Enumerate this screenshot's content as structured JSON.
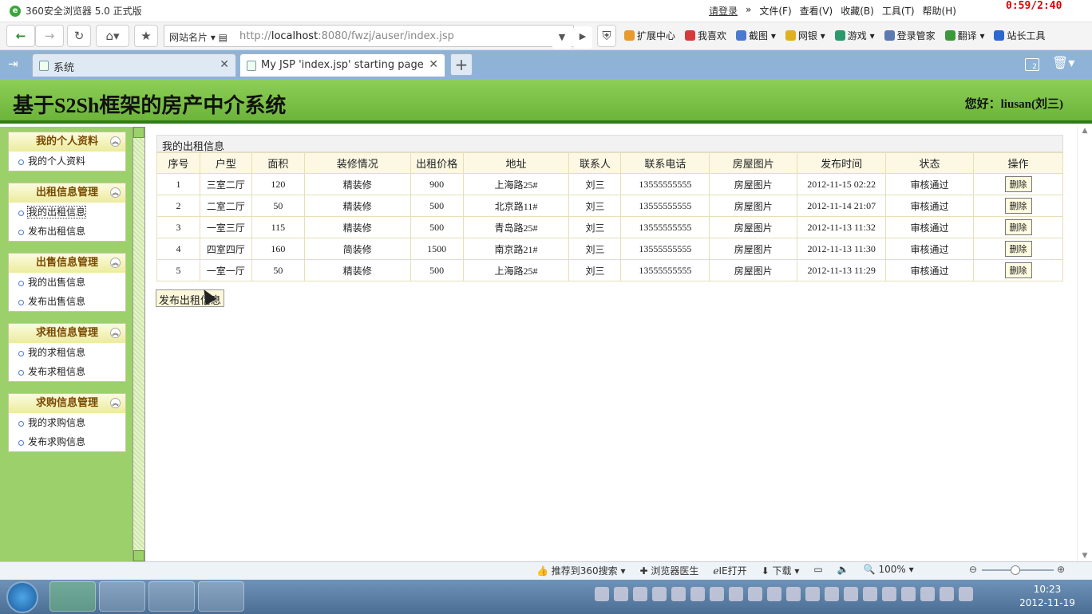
{
  "browser": {
    "title": "360安全浏览器 5.0 正式版",
    "login": "请登录",
    "menus": [
      "文件(F)",
      "查看(V)",
      "收藏(B)",
      "工具(T)",
      "帮助(H)"
    ],
    "overlay_timer": "0:59/2:40",
    "site_card": "网站名片",
    "url_prefix": "http://",
    "url_host": "localhost",
    "url_rest": ":8080/fwzj/auser/index.jsp",
    "extensions": [
      "扩展中心",
      "我喜欢",
      "截图",
      "网银",
      "游戏",
      "登录管家",
      "翻译",
      "站长工具"
    ],
    "tabs": [
      {
        "label": "系统"
      },
      {
        "label": "My JSP 'index.jsp' starting page"
      }
    ],
    "tab_count": "2"
  },
  "page": {
    "site_title": "基于S2Sh框架的房产中介系统",
    "greeting": "您好：liusan(刘三)",
    "sidebar": [
      {
        "title": "我的个人资料",
        "items": [
          "我的个人资料"
        ]
      },
      {
        "title": "出租信息管理",
        "items": [
          "我的出租信息",
          "发布出租信息"
        ]
      },
      {
        "title": "出售信息管理",
        "items": [
          "我的出售信息",
          "发布出售信息"
        ]
      },
      {
        "title": "求租信息管理",
        "items": [
          "我的求租信息",
          "发布求租信息"
        ]
      },
      {
        "title": "求购信息管理",
        "items": [
          "我的求购信息",
          "发布求购信息"
        ]
      }
    ],
    "table_caption": "我的出租信息",
    "columns": [
      "序号",
      "户型",
      "面积",
      "装修情况",
      "出租价格",
      "地址",
      "联系人",
      "联系电话",
      "房屋图片",
      "发布时间",
      "状态",
      "操作"
    ],
    "rows": [
      [
        "1",
        "三室二厅",
        "120",
        "精装修",
        "900",
        "上海路25#",
        "刘三",
        "13555555555",
        "房屋图片",
        "2012-11-15 02:22",
        "审核通过",
        "删除"
      ],
      [
        "2",
        "二室二厅",
        "50",
        "精装修",
        "500",
        "北京路11#",
        "刘三",
        "13555555555",
        "房屋图片",
        "2012-11-14 21:07",
        "审核通过",
        "删除"
      ],
      [
        "3",
        "一室三厅",
        "115",
        "精装修",
        "500",
        "青岛路25#",
        "刘三",
        "13555555555",
        "房屋图片",
        "2012-11-13 11:32",
        "审核通过",
        "删除"
      ],
      [
        "4",
        "四室四厅",
        "160",
        "简装修",
        "1500",
        "南京路21#",
        "刘三",
        "13555555555",
        "房屋图片",
        "2012-11-13 11:30",
        "审核通过",
        "删除"
      ],
      [
        "5",
        "一室一厅",
        "50",
        "精装修",
        "500",
        "上海路25#",
        "刘三",
        "13555555555",
        "房屋图片",
        "2012-11-13 11:29",
        "审核通过",
        "删除"
      ]
    ],
    "publish_button": "发布出租信息"
  },
  "statusbar": {
    "items": [
      "推荐到360搜索",
      "浏览器医生",
      "IE打开",
      "下载"
    ],
    "zoom": "100%"
  },
  "taskbar": {
    "time": "10:23",
    "date": "2012-11-19"
  }
}
